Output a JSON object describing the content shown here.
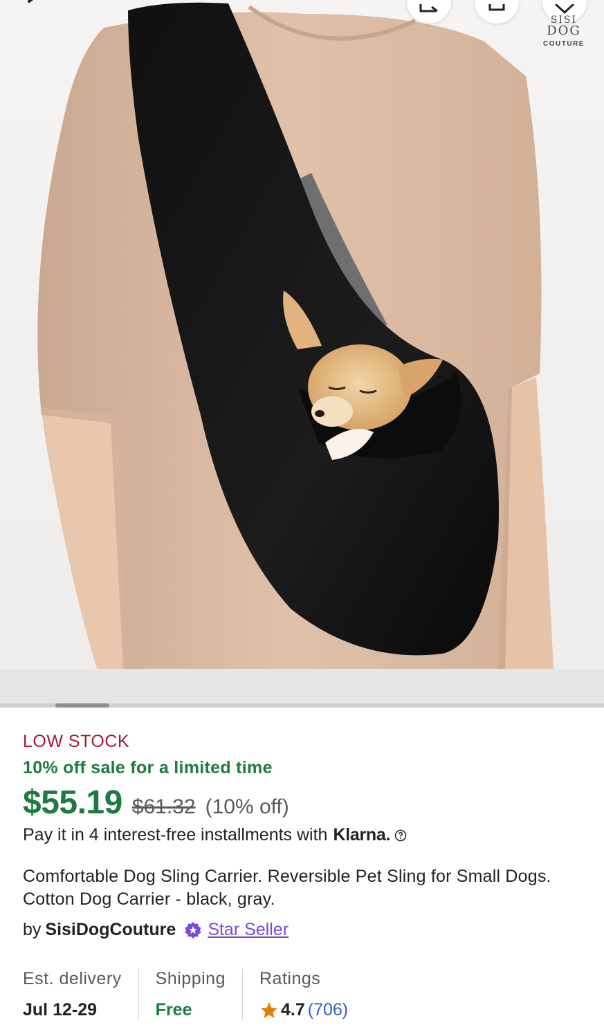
{
  "product": {
    "image_alt": "Dog sling carrier worn by a person with a sleeping chihuahua",
    "brand_logo": {
      "line1": "SISI",
      "line2": "DOG",
      "line3": "COUTURE"
    },
    "stock_status": "LOW STOCK",
    "sale_text": "10% off sale for a limited time",
    "price": "$55.19",
    "original_price": "$61.32",
    "discount": "(10% off)",
    "installments_text": "Pay it in 4 interest-free installments with",
    "klarna_label": "Klarna.",
    "title": "Comfortable Dog Sling Carrier. Reversible Pet Sling for Small Dogs. Cotton Dog Carrier - black, gray.",
    "seller_prefix": "by",
    "seller_name": "SisiDogCouture",
    "star_seller_label": "Star Seller"
  },
  "stats": {
    "delivery": {
      "label": "Est. delivery",
      "value": "Jul 12-29"
    },
    "shipping": {
      "label": "Shipping",
      "value": "Free"
    },
    "ratings": {
      "label": "Ratings",
      "score": "4.7",
      "count": "(706)"
    }
  },
  "icons": {
    "back": "chevron-left-icon",
    "share": "share-icon",
    "cart": "cart-icon",
    "favorite": "heart-icon",
    "help": "question-circle-icon",
    "star_seller": "star-badge-icon",
    "rating_star": "star-icon"
  },
  "colors": {
    "low_stock": "#a61a2e",
    "sale_green": "#1e7b3f",
    "star_seller_purple": "#7a4ad6",
    "link_blue": "#2f5ec4",
    "star_orange": "#e3810b"
  }
}
